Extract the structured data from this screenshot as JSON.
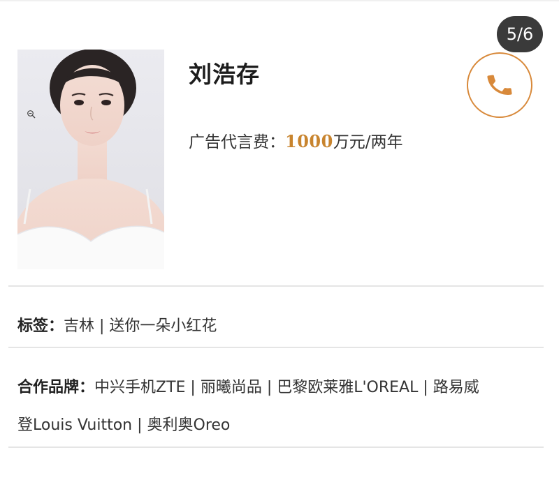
{
  "counter": {
    "text": "5/6"
  },
  "profile": {
    "name": "刘浩存",
    "fee_label": "广告代言费：",
    "fee_value": "1000",
    "fee_unit": "万元/两年"
  },
  "tags": {
    "label": "标签：",
    "value": "吉林 | 送你一朵小红花"
  },
  "brands": {
    "label": "合作品牌：",
    "line1": "中兴手机ZTE | 丽曦尚品 | 巴黎欧莱雅L'OREAL | 路易威",
    "line2": "登Louis Vuitton | 奥利奥Oreo"
  },
  "icons": {
    "call": "phone-icon",
    "zoom": "zoom-icon"
  },
  "colors": {
    "accent": "#c8842e",
    "call_border": "#d8893a",
    "counter_bg": "#3a3a3a"
  }
}
